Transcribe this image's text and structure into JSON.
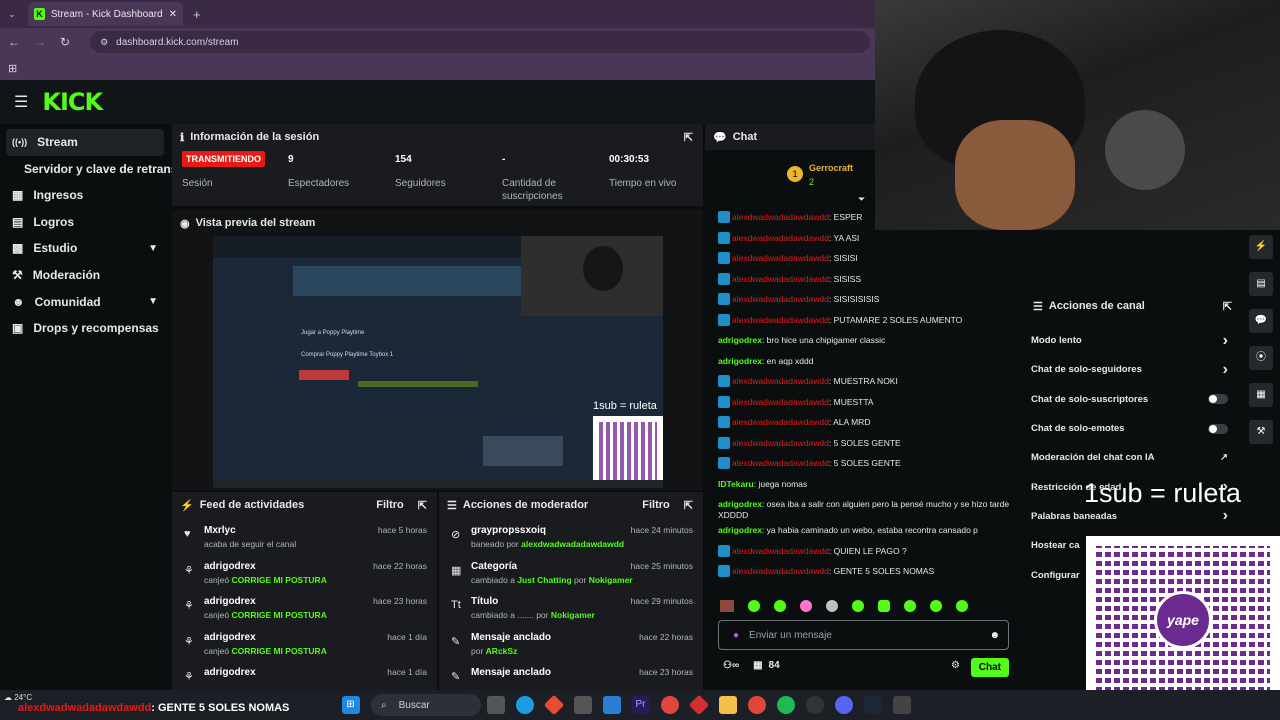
{
  "browser": {
    "tab_title": "Stream - Kick Dashboard",
    "url": "dashboard.kick.com/stream"
  },
  "sidebar": {
    "items": [
      {
        "label": "Stream"
      },
      {
        "label": "Servidor y clave de retransm"
      },
      {
        "label": "Ingresos"
      },
      {
        "label": "Logros"
      },
      {
        "label": "Estudio"
      },
      {
        "label": "Moderación"
      },
      {
        "label": "Comunidad"
      },
      {
        "label": "Drops y recompensas"
      }
    ]
  },
  "session": {
    "title": "Información de la sesión",
    "status_badge": "TRANSMITIENDO",
    "status_label": "Sesión",
    "viewers_value": "9",
    "viewers_label": "Espectadores",
    "followers_value": "154",
    "followers_label": "Seguidores",
    "subs_value": "-",
    "subs_label": "Cantidad de suscripciones",
    "time_value": "00:30:53",
    "time_label": "Tiempo en vivo"
  },
  "preview": {
    "title": "Vista previa del stream",
    "overlay": "1sub = ruleta",
    "game_text": "Jugar a Poppy Playtime",
    "buy_text": "Comprar Poppy Playtime Toybox 1"
  },
  "activity_feed": {
    "title": "Feed de actividades",
    "filter": "Filtro",
    "items": [
      {
        "who": "Mxrlyc",
        "what": "acaba de seguir el canal",
        "highlight": "",
        "when": "hace 5 horas"
      },
      {
        "who": "adrigodrex",
        "what": "canjeó",
        "highlight": "CORRIGE MI POSTURA",
        "when": "hace 22 horas"
      },
      {
        "who": "adrigodrex",
        "what": "canjeó",
        "highlight": "CORRIGE MI POSTURA",
        "when": "hace 23 horas"
      },
      {
        "who": "adrigodrex",
        "what": "canjeó",
        "highlight": "CORRIGE MI POSTURA",
        "when": "hace 1 día"
      },
      {
        "who": "adrigodrex",
        "what": "",
        "highlight": "",
        "when": "hace 1 día"
      }
    ]
  },
  "mod_actions": {
    "title": "Acciones de moderador",
    "filter": "Filtro",
    "items": [
      {
        "who": "graypropssxoiq",
        "what": "baneado por",
        "highlight": "alexdwadwadadawdawdd",
        "when": "hace 24 minutos"
      },
      {
        "who": "Categoría",
        "what": "cambiado a",
        "highlight": "Just Chatting",
        "extra": "por",
        "by": "Nokigamer",
        "when": "hace 25 minutos"
      },
      {
        "who": "Título",
        "what": "cambiado a ....... por",
        "highlight": "Nokigamer",
        "when": "hace 29 minutos"
      },
      {
        "who": "Mensaje anclado",
        "what": "por",
        "highlight": "ARckSz",
        "when": "hace 22 horas"
      },
      {
        "who": "Mensaje anclado",
        "what": "",
        "highlight": "",
        "when": "hace 23 horas"
      }
    ]
  },
  "chat": {
    "title": "Chat",
    "pinned_user": "Gerrocraft",
    "pinned_count": "2",
    "input_placeholder": "Enviar un mensaje",
    "viewer_count": "84",
    "send_label": "Chat",
    "messages": [
      {
        "user": "alexdwadwadadawdawdd",
        "type": "red",
        "text": "ESPER"
      },
      {
        "user": "alexdwadwadadawdawdd",
        "type": "red",
        "text": "YA ASI"
      },
      {
        "user": "alexdwadwadadawdawdd",
        "type": "red",
        "text": "SISISI"
      },
      {
        "user": "alexdwadwadadawdawdd",
        "type": "red",
        "text": "SISISS"
      },
      {
        "user": "alexdwadwadadawdawdd",
        "type": "red",
        "text": "SISISISISIS"
      },
      {
        "user": "alexdwadwadadawdawdd",
        "type": "red",
        "text": "PUTAMARE 2 SOLES AUMENTO"
      },
      {
        "user": "adrigodrex",
        "type": "green",
        "text": "bro hice una chipigamer classic"
      },
      {
        "user": "adrigodrex",
        "type": "green",
        "text": "en aqp xddd"
      },
      {
        "user": "alexdwadwadadawdawdd",
        "type": "red",
        "text": "MUESTRA NOKI"
      },
      {
        "user": "alexdwadwadadawdawdd",
        "type": "red",
        "text": "MUESTTA"
      },
      {
        "user": "alexdwadwadadawdawdd",
        "type": "red",
        "text": "ALA MRD"
      },
      {
        "user": "alexdwadwadadawdawdd",
        "type": "red",
        "text": "5 SOLES GENTE"
      },
      {
        "user": "alexdwadwadadawdawdd",
        "type": "red",
        "text": "5 SOLES GENTE"
      },
      {
        "user": "IDTekaru",
        "type": "green",
        "text": "juega nomas"
      },
      {
        "user": "adrigodrex",
        "type": "green",
        "text": "osea iba a salir con alguien pero la pensé mucho y se hizo tarde XDDDD"
      },
      {
        "user": "adrigodrex",
        "type": "green",
        "text": "ya habia caminado un webo, estaba recontra cansado p"
      },
      {
        "user": "alexdwadwadadawdawdd",
        "type": "red",
        "text": "QUIEN LE PAGO ?"
      },
      {
        "user": "alexdwadwadadawdawdd",
        "type": "red",
        "text": "GENTE 5 SOLES NOMAS"
      }
    ]
  },
  "channel_actions": {
    "title": "Acciones de canal",
    "items": [
      {
        "label": "Modo lento",
        "kind": "arrow"
      },
      {
        "label": "Chat de solo-seguidores",
        "kind": "arrow"
      },
      {
        "label": "Chat de solo-suscriptores",
        "kind": "toggle"
      },
      {
        "label": "Chat de solo-emotes",
        "kind": "toggle"
      },
      {
        "label": "Moderación del chat con IA",
        "kind": "link"
      },
      {
        "label": "Restricción de edad",
        "kind": "arrow"
      },
      {
        "label": "Palabras baneadas",
        "kind": "arrow"
      },
      {
        "label": "Hostear ca",
        "kind": "none"
      },
      {
        "label": "Configurar",
        "kind": "none"
      }
    ]
  },
  "overlay": {
    "right_text": "1sub = ruleta",
    "qr_brand": "yape",
    "ticker_user": "alexdwadwadadawdawdd",
    "ticker_text": ": GENTE 5 SOLES NOMAS",
    "weather": "24°C"
  },
  "taskbar": {
    "search_label": "Buscar"
  },
  "colors": {
    "kick_green": "#53fc18",
    "live_red": "#e91916",
    "panel_bg": "#191b1f"
  }
}
